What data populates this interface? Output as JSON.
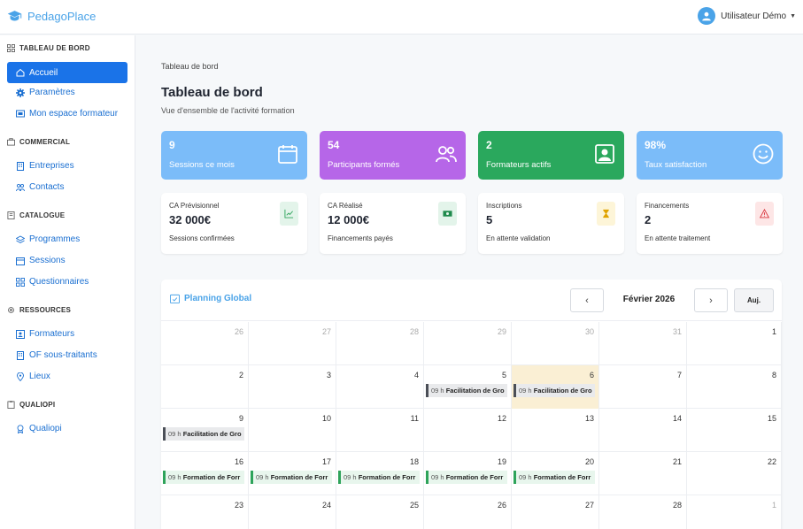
{
  "app": {
    "brand": "PedagoPlace",
    "user_name": "Utilisateur Démo"
  },
  "sidebar": {
    "sections": [
      {
        "title": "TABLEAU DE BORD"
      },
      {
        "title": "COMMERCIAL"
      },
      {
        "title": "CATALOGUE"
      },
      {
        "title": "RESSOURCES"
      },
      {
        "title": "QUALIOPI"
      }
    ],
    "items": [
      {
        "label": "Accueil"
      },
      {
        "label": "Paramètres"
      },
      {
        "label": "Mon espace formateur"
      },
      {
        "label": "Entreprises"
      },
      {
        "label": "Contacts"
      },
      {
        "label": "Programmes"
      },
      {
        "label": "Sessions"
      },
      {
        "label": "Questionnaires"
      },
      {
        "label": "Formateurs"
      },
      {
        "label": "OF sous-traitants"
      },
      {
        "label": "Lieux"
      },
      {
        "label": "Qualiopi"
      }
    ]
  },
  "main": {
    "breadcrumb": "Tableau de bord",
    "title": "Tableau de bord",
    "subtitle": "Vue d'ensemble de l'activité formation"
  },
  "stats": [
    {
      "value": "9",
      "label": "Sessions ce mois",
      "color": "#7bbcf9",
      "icon": "calendar-icon"
    },
    {
      "value": "54",
      "label": "Participants formés",
      "color": "#b666e8",
      "icon": "users-icon"
    },
    {
      "value": "2",
      "label": "Formateurs actifs",
      "color": "#2aa85d",
      "icon": "trainer-icon"
    },
    {
      "value": "98%",
      "label": "Taux satisfaction",
      "color": "#7bbcf9",
      "icon": "smile-icon"
    }
  ],
  "kpis": [
    {
      "title": "CA Prévisionnel",
      "value": "32 000€",
      "sub": "Sessions confirmées",
      "icon": "chart-icon",
      "bg": "#e3f4ea",
      "fg": "#2ea35a"
    },
    {
      "title": "CA Réalisé",
      "value": "12 000€",
      "sub": "Financements payés",
      "icon": "money-icon",
      "bg": "#e3f4ea",
      "fg": "#1f8a4c"
    },
    {
      "title": "Inscriptions",
      "value": "5",
      "sub": "En attente validation",
      "icon": "hourglass-icon",
      "bg": "#fdf5d8",
      "fg": "#e0a300"
    },
    {
      "title": "Financements",
      "value": "2",
      "sub": "En attente traitement",
      "icon": "warning-icon",
      "bg": "#fde6e6",
      "fg": "#d9363e"
    }
  ],
  "calendar": {
    "title": "Planning Global",
    "month": "Février 2026",
    "prev": "‹",
    "next": "›",
    "today_label": "Auj.",
    "weeks": [
      {
        "days": [
          {
            "n": "26",
            "other": true
          },
          {
            "n": "27",
            "other": true
          },
          {
            "n": "28",
            "other": true
          },
          {
            "n": "29",
            "other": true
          },
          {
            "n": "30",
            "other": true
          },
          {
            "n": "31",
            "other": true
          },
          {
            "n": "1"
          }
        ]
      },
      {
        "days": [
          {
            "n": "2"
          },
          {
            "n": "3"
          },
          {
            "n": "4"
          },
          {
            "n": "5",
            "ev": {
              "time": "09 h",
              "name": "Facilitation de Gro",
              "kind": "grey"
            }
          },
          {
            "n": "6",
            "today": true,
            "ev": {
              "time": "09 h",
              "name": "Facilitation de Gro",
              "kind": "grey"
            }
          },
          {
            "n": "7"
          },
          {
            "n": "8"
          }
        ]
      },
      {
        "days": [
          {
            "n": "9",
            "ev": {
              "time": "09 h",
              "name": "Facilitation de Gro",
              "kind": "grey"
            }
          },
          {
            "n": "10"
          },
          {
            "n": "11"
          },
          {
            "n": "12"
          },
          {
            "n": "13"
          },
          {
            "n": "14"
          },
          {
            "n": "15"
          }
        ]
      },
      {
        "days": [
          {
            "n": "16",
            "ev": {
              "time": "09 h",
              "name": "Formation de Forr",
              "kind": "green"
            }
          },
          {
            "n": "17",
            "ev": {
              "time": "09 h",
              "name": "Formation de Forr",
              "kind": "green"
            }
          },
          {
            "n": "18",
            "ev": {
              "time": "09 h",
              "name": "Formation de Forr",
              "kind": "green"
            }
          },
          {
            "n": "19",
            "ev": {
              "time": "09 h",
              "name": "Formation de Forr",
              "kind": "green"
            }
          },
          {
            "n": "20",
            "ev": {
              "time": "09 h",
              "name": "Formation de Forr",
              "kind": "green"
            }
          },
          {
            "n": "21"
          },
          {
            "n": "22"
          }
        ]
      },
      {
        "days": [
          {
            "n": "23"
          },
          {
            "n": "24"
          },
          {
            "n": "25"
          },
          {
            "n": "26"
          },
          {
            "n": "27"
          },
          {
            "n": "28"
          },
          {
            "n": "1",
            "other": true
          }
        ]
      }
    ]
  }
}
